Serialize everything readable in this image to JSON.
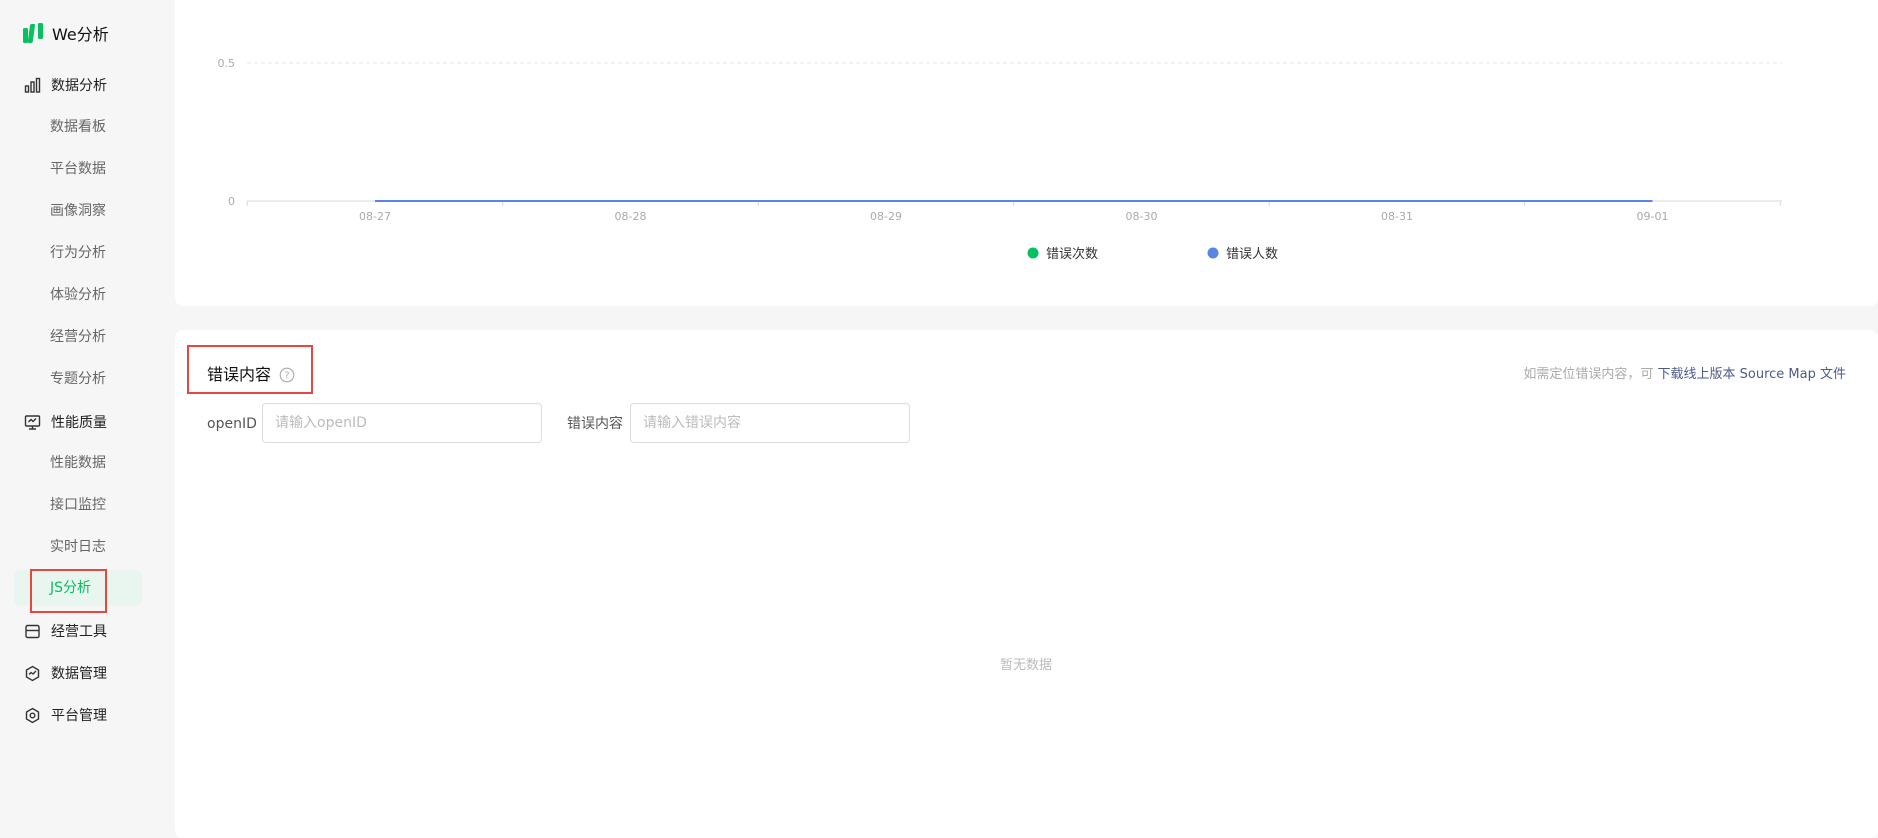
{
  "app": {
    "title": "We分析"
  },
  "sidebar": {
    "groups": [
      {
        "label": "数据分析",
        "icon": "bar-chart-icon",
        "items": [
          "数据看板",
          "平台数据",
          "画像洞察",
          "行为分析",
          "体验分析",
          "经营分析",
          "专题分析"
        ]
      },
      {
        "label": "性能质量",
        "icon": "monitor-icon",
        "items": [
          "性能数据",
          "接口监控",
          "实时日志",
          "JS分析"
        ]
      },
      {
        "label": "经营工具",
        "icon": "storefront-icon",
        "items": []
      },
      {
        "label": "数据管理",
        "icon": "data-manage-icon",
        "items": []
      },
      {
        "label": "平台管理",
        "icon": "hexagon-settings-icon",
        "items": []
      }
    ],
    "active_item": "JS分析"
  },
  "chart_data": {
    "type": "line",
    "x": [
      "08-27",
      "08-28",
      "08-29",
      "08-30",
      "08-31",
      "09-01"
    ],
    "yticks": [
      0,
      0.5
    ],
    "ylim": [
      0,
      0.5
    ],
    "grid": true,
    "legend_position": "bottom",
    "series": [
      {
        "name": "错误次数",
        "color": "#07c160",
        "values": [
          0,
          0,
          0,
          0,
          0,
          0
        ]
      },
      {
        "name": "错误人数",
        "color": "#5b84e8",
        "values": [
          0,
          0,
          0,
          0,
          0,
          0
        ]
      }
    ]
  },
  "content": {
    "title": "错误内容",
    "hint_text": "如需定位错误内容，可",
    "hint_link": "下载线上版本 Source Map 文件",
    "filters": {
      "openid_label": "openID",
      "openid_placeholder": "请输入openID",
      "error_label": "错误内容",
      "error_placeholder": "请输入错误内容"
    },
    "empty_text": "暂无数据"
  },
  "colors": {
    "accent": "#07c160",
    "highlight": "#e5483f",
    "link": "#4c5a8a"
  }
}
